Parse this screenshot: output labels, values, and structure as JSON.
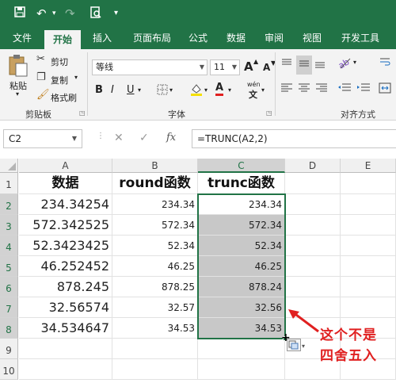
{
  "qat": {
    "undo_label": "↶",
    "redo_label": "↷",
    "customize_label": "▾"
  },
  "tabs": [
    "文件",
    "开始",
    "插入",
    "页面布局",
    "公式",
    "数据",
    "审阅",
    "视图",
    "开发工具"
  ],
  "active_tab": "开始",
  "ribbon": {
    "paste_label": "粘贴",
    "cut_label": "剪切",
    "copy_label": "复制",
    "format_painter_label": "格式刷",
    "clipboard_group": "剪贴板",
    "font_name": "等线",
    "font_size": "11",
    "increase_font": "A",
    "decrease_font": "A",
    "bold": "B",
    "italic": "I",
    "underline": "U",
    "font_color_label": "A",
    "phonetic_label": "wén",
    "font_group": "字体",
    "align_group": "对齐方式"
  },
  "formula_bar": {
    "name_box": "C2",
    "fx_label": "fx",
    "formula": "=TRUNC(A2,2)"
  },
  "columns": [
    "A",
    "B",
    "C",
    "D",
    "E"
  ],
  "selected_column": "C",
  "rows": [
    "1",
    "2",
    "3",
    "4",
    "5",
    "6",
    "7",
    "8",
    "9",
    "10"
  ],
  "headers": {
    "a": "数据",
    "b": "round函数",
    "c": "trunc函数"
  },
  "data": [
    {
      "a": "234.34254",
      "b": "234.34",
      "c": "234.34"
    },
    {
      "a": "572.342525",
      "b": "572.34",
      "c": "572.34"
    },
    {
      "a": "52.3423425",
      "b": "52.34",
      "c": "52.34"
    },
    {
      "a": "46.252452",
      "b": "46.25",
      "c": "46.25"
    },
    {
      "a": "878.245",
      "b": "878.25",
      "c": "878.24"
    },
    {
      "a": "32.56574",
      "b": "32.57",
      "c": "32.56"
    },
    {
      "a": "34.534647",
      "b": "34.53",
      "c": "34.53"
    }
  ],
  "annotation": {
    "line1": "这个不是",
    "line2": "四舍五入"
  },
  "colors": {
    "brand": "#217346",
    "annotation": "#e02020",
    "selection_fill": "#c8c8c8"
  }
}
